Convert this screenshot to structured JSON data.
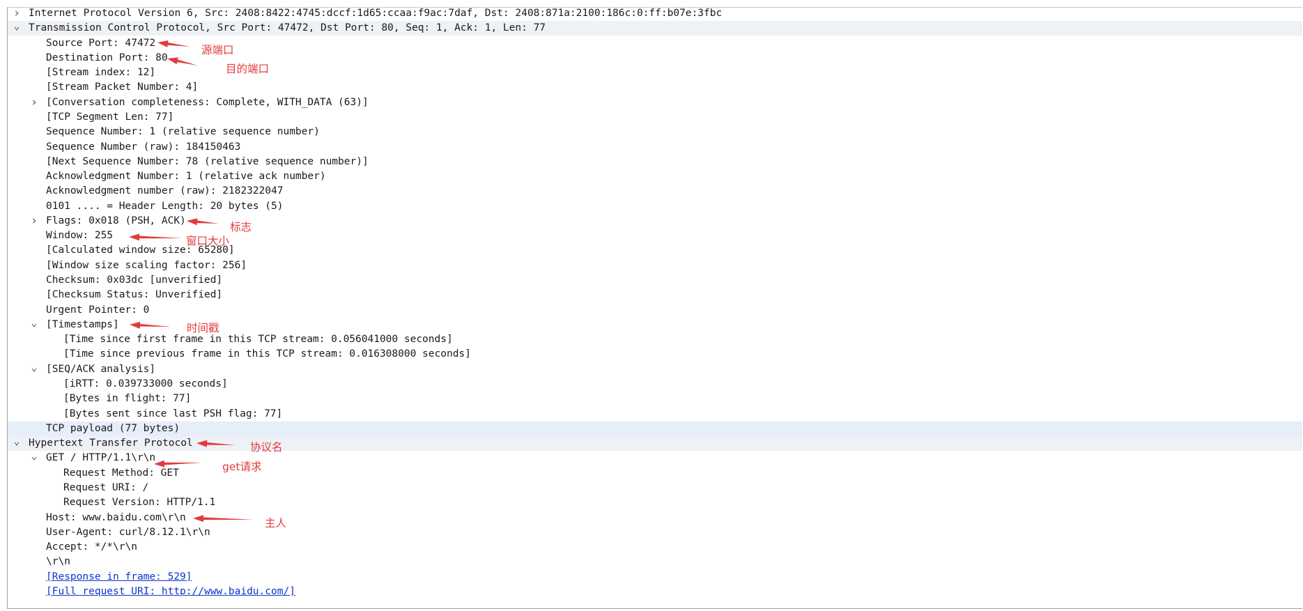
{
  "tree": [
    {
      "text": "Internet Protocol Version 6, Src: 2408:8422:4745:dccf:1d65:ccaa:f9ac:7daf, Dst: 2408:871a:2100:186c:0:ff:b07e:3fbc",
      "level": 0,
      "expander": "collapsed"
    },
    {
      "text": "Transmission Control Protocol, Src Port: 47472, Dst Port: 80, Seq: 1, Ack: 1, Len: 77",
      "level": 0,
      "expander": "expanded",
      "selected": true
    },
    {
      "text": "Source Port: 47472",
      "level": 1
    },
    {
      "text": "Destination Port: 80",
      "level": 1
    },
    {
      "text": "[Stream index: 12]",
      "level": 1
    },
    {
      "text": "[Stream Packet Number: 4]",
      "level": 1
    },
    {
      "text": "[Conversation completeness: Complete, WITH_DATA (63)]",
      "level": 1,
      "expander": "collapsed"
    },
    {
      "text": "[TCP Segment Len: 77]",
      "level": 1
    },
    {
      "text": "Sequence Number: 1    (relative sequence number)",
      "level": 1
    },
    {
      "text": "Sequence Number (raw): 184150463",
      "level": 1
    },
    {
      "text": "[Next Sequence Number: 78    (relative sequence number)]",
      "level": 1
    },
    {
      "text": "Acknowledgment Number: 1    (relative ack number)",
      "level": 1
    },
    {
      "text": "Acknowledgment number (raw): 2182322047",
      "level": 1
    },
    {
      "text": "0101 .... = Header Length: 20 bytes (5)",
      "level": 1
    },
    {
      "text": "Flags: 0x018 (PSH, ACK)",
      "level": 1,
      "expander": "collapsed"
    },
    {
      "text": "Window: 255",
      "level": 1
    },
    {
      "text": "[Calculated window size: 65280]",
      "level": 1
    },
    {
      "text": "[Window size scaling factor: 256]",
      "level": 1
    },
    {
      "text": "Checksum: 0x03dc [unverified]",
      "level": 1
    },
    {
      "text": "[Checksum Status: Unverified]",
      "level": 1
    },
    {
      "text": "Urgent Pointer: 0",
      "level": 1
    },
    {
      "text": "[Timestamps]",
      "level": 1,
      "expander": "expanded"
    },
    {
      "text": "[Time since first frame in this TCP stream: 0.056041000 seconds]",
      "level": 2
    },
    {
      "text": "[Time since previous frame in this TCP stream: 0.016308000 seconds]",
      "level": 2
    },
    {
      "text": "[SEQ/ACK analysis]",
      "level": 1,
      "expander": "expanded"
    },
    {
      "text": "[iRTT: 0.039733000 seconds]",
      "level": 2
    },
    {
      "text": "[Bytes in flight: 77]",
      "level": 2
    },
    {
      "text": "[Bytes sent since last PSH flag: 77]",
      "level": 2
    },
    {
      "text": "TCP payload (77 bytes)",
      "level": 1,
      "highlighted": true
    },
    {
      "text": "Hypertext Transfer Protocol",
      "level": 0,
      "expander": "expanded",
      "selected": true
    },
    {
      "text": "GET / HTTP/1.1\\r\\n",
      "level": 1,
      "expander": "expanded"
    },
    {
      "text": "Request Method: GET",
      "level": 2
    },
    {
      "text": "Request URI: /",
      "level": 2
    },
    {
      "text": "Request Version: HTTP/1.1",
      "level": 2
    },
    {
      "text": "Host: www.baidu.com\\r\\n",
      "level": 1
    },
    {
      "text": "User-Agent: curl/8.12.1\\r\\n",
      "level": 1
    },
    {
      "text": "Accept: */*\\r\\n",
      "level": 1
    },
    {
      "text": "\\r\\n",
      "level": 1
    },
    {
      "text": "[Response in frame: 529]",
      "level": 1,
      "link": true
    },
    {
      "text": "[Full request URI: http://www.baidu.com/]",
      "level": 1,
      "link": true
    }
  ],
  "icons": {
    "collapsed": "chevron-right-icon",
    "expanded": "chevron-down-icon"
  },
  "annotations": [
    {
      "text": "源端口",
      "row": 2
    },
    {
      "text": "目的端口",
      "row": 3
    },
    {
      "text": "标志",
      "row": 14
    },
    {
      "text": "窗口大小",
      "row": 15
    },
    {
      "text": "时间戳",
      "row": 21
    },
    {
      "text": "协议名",
      "row": 29
    },
    {
      "text": "get请求",
      "row": 30
    },
    {
      "text": "主人",
      "row": 34
    }
  ],
  "colors": {
    "annotation": "#e33b3b",
    "link": "#0a35c9",
    "selected_row": "#eef1f6",
    "highlight_row": "#e5eef9"
  }
}
